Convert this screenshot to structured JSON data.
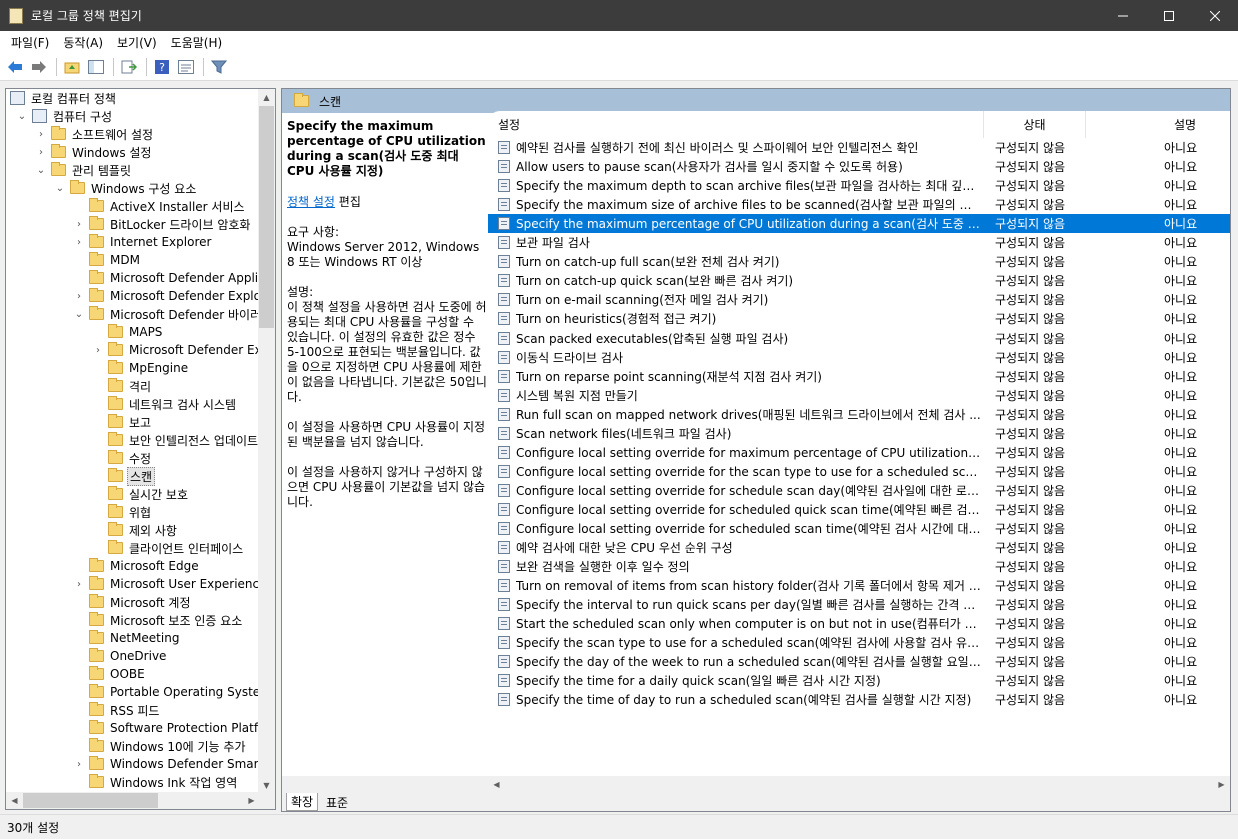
{
  "window": {
    "title": "로컬 그룹 정책 편집기"
  },
  "menu": [
    "파일(F)",
    "동작(A)",
    "보기(V)",
    "도움말(H)"
  ],
  "tree": [
    {
      "label": "로컬 컴퓨터 정책",
      "level": 0,
      "exp": "",
      "icon": "computer-policy-icon"
    },
    {
      "label": "컴퓨터 구성",
      "level": 1,
      "exp": "open",
      "icon": "computer-icon"
    },
    {
      "label": "소프트웨어 설정",
      "level": 2,
      "exp": "closed",
      "icon": "folder-icon"
    },
    {
      "label": "Windows 설정",
      "level": 2,
      "exp": "closed",
      "icon": "folder-icon"
    },
    {
      "label": "관리 템플릿",
      "level": 2,
      "exp": "open",
      "icon": "folder-icon"
    },
    {
      "label": "Windows 구성 요소",
      "level": 3,
      "exp": "open",
      "icon": "folder-icon"
    },
    {
      "label": "ActiveX Installer 서비스",
      "level": 4,
      "exp": "",
      "icon": "folder-icon"
    },
    {
      "label": "BitLocker 드라이브 암호화",
      "level": 4,
      "exp": "closed",
      "icon": "folder-icon"
    },
    {
      "label": "Internet Explorer",
      "level": 4,
      "exp": "closed",
      "icon": "folder-icon"
    },
    {
      "label": "MDM",
      "level": 4,
      "exp": "",
      "icon": "folder-icon"
    },
    {
      "label": "Microsoft Defender Applicat",
      "level": 4,
      "exp": "",
      "icon": "folder-icon"
    },
    {
      "label": "Microsoft Defender Exploit G",
      "level": 4,
      "exp": "closed",
      "icon": "folder-icon"
    },
    {
      "label": "Microsoft Defender 바이러스",
      "level": 4,
      "exp": "open",
      "icon": "folder-icon"
    },
    {
      "label": "MAPS",
      "level": 5,
      "exp": "",
      "icon": "folder-icon"
    },
    {
      "label": "Microsoft Defender Exploi",
      "level": 5,
      "exp": "closed",
      "icon": "folder-icon"
    },
    {
      "label": "MpEngine",
      "level": 5,
      "exp": "",
      "icon": "folder-icon"
    },
    {
      "label": "격리",
      "level": 5,
      "exp": "",
      "icon": "folder-icon"
    },
    {
      "label": "네트워크 검사 시스템",
      "level": 5,
      "exp": "",
      "icon": "folder-icon"
    },
    {
      "label": "보고",
      "level": 5,
      "exp": "",
      "icon": "folder-icon"
    },
    {
      "label": "보안 인텔리전스 업데이트",
      "level": 5,
      "exp": "",
      "icon": "folder-icon"
    },
    {
      "label": "수정",
      "level": 5,
      "exp": "",
      "icon": "folder-icon"
    },
    {
      "label": "스캔",
      "level": 5,
      "exp": "",
      "icon": "folder-icon",
      "selected": true
    },
    {
      "label": "실시간 보호",
      "level": 5,
      "exp": "",
      "icon": "folder-icon"
    },
    {
      "label": "위협",
      "level": 5,
      "exp": "",
      "icon": "folder-icon"
    },
    {
      "label": "제외 사항",
      "level": 5,
      "exp": "",
      "icon": "folder-icon"
    },
    {
      "label": "클라이언트 인터페이스",
      "level": 5,
      "exp": "",
      "icon": "folder-icon"
    },
    {
      "label": "Microsoft Edge",
      "level": 4,
      "exp": "",
      "icon": "folder-icon"
    },
    {
      "label": "Microsoft User Experience V",
      "level": 4,
      "exp": "closed",
      "icon": "folder-icon"
    },
    {
      "label": "Microsoft 계정",
      "level": 4,
      "exp": "",
      "icon": "folder-icon"
    },
    {
      "label": "Microsoft 보조 인증 요소",
      "level": 4,
      "exp": "",
      "icon": "folder-icon"
    },
    {
      "label": "NetMeeting",
      "level": 4,
      "exp": "",
      "icon": "folder-icon"
    },
    {
      "label": "OneDrive",
      "level": 4,
      "exp": "",
      "icon": "folder-icon"
    },
    {
      "label": "OOBE",
      "level": 4,
      "exp": "",
      "icon": "folder-icon"
    },
    {
      "label": "Portable Operating System",
      "level": 4,
      "exp": "",
      "icon": "folder-icon"
    },
    {
      "label": "RSS 피드",
      "level": 4,
      "exp": "",
      "icon": "folder-icon"
    },
    {
      "label": "Software Protection Platform",
      "level": 4,
      "exp": "",
      "icon": "folder-icon"
    },
    {
      "label": "Windows 10에 기능 추가",
      "level": 4,
      "exp": "",
      "icon": "folder-icon"
    },
    {
      "label": "Windows Defender SmartSc",
      "level": 4,
      "exp": "closed",
      "icon": "folder-icon"
    },
    {
      "label": "Windows Ink 작업 영역",
      "level": 4,
      "exp": "",
      "icon": "folder-icon"
    }
  ],
  "header": {
    "title": "스캔"
  },
  "description": {
    "title": "Specify the maximum percentage of CPU utilization during a scan(검사 도중 최대 CPU 사용률 지정)",
    "edit_link": "정책 설정",
    "edit_suffix": " 편집",
    "req_label": "요구 사항:",
    "req_text": "Windows Server 2012, Windows 8 또는 Windows RT 이상",
    "desc_label": "설명:",
    "desc_text": "이 정책 설정을 사용하면 검사 도중에 허용되는 최대 CPU 사용률을 구성할 수 있습니다. 이 설정의 유효한 값은 정수 5-100으로 표현되는 백분율입니다. 값을 0으로 지정하면 CPU 사용률에 제한이 없음을 나타냅니다. 기본값은 50입니다.",
    "p2": "이 설정을 사용하면 CPU 사용률이 지정된 백분율을 넘지 않습니다.",
    "p3": "이 설정을 사용하지 않거나 구성하지 않으면 CPU 사용률이 기본값을 넘지 않습니다."
  },
  "columns": {
    "setting": "설정",
    "state": "상태",
    "comment": "설명"
  },
  "settings": [
    {
      "name": "예약된 검사를 실행하기 전에 최신 바이러스 및 스파이웨어 보안 인텔리전스 확인",
      "state": "구성되지 않음",
      "comment": "아니요"
    },
    {
      "name": "Allow users to pause scan(사용자가 검사를 일시 중지할 수 있도록 허용)",
      "state": "구성되지 않음",
      "comment": "아니요"
    },
    {
      "name": "Specify the maximum depth to scan archive files(보관 파일을 검사하는 최대 깊이 지...",
      "state": "구성되지 않음",
      "comment": "아니요"
    },
    {
      "name": "Specify the maximum size of archive files to be scanned(검사할 보관 파일의 최대 ...",
      "state": "구성되지 않음",
      "comment": "아니요"
    },
    {
      "name": "Specify the maximum percentage of CPU utilization during a scan(검사 도중 최대 C...",
      "state": "구성되지 않음",
      "comment": "아니요",
      "selected": true
    },
    {
      "name": "보관 파일 검사",
      "state": "구성되지 않음",
      "comment": "아니요"
    },
    {
      "name": "Turn on catch-up full scan(보완 전체 검사 켜기)",
      "state": "구성되지 않음",
      "comment": "아니요"
    },
    {
      "name": "Turn on catch-up quick scan(보완 빠른 검사 켜기)",
      "state": "구성되지 않음",
      "comment": "아니요"
    },
    {
      "name": "Turn on e-mail scanning(전자 메일 검사 켜기)",
      "state": "구성되지 않음",
      "comment": "아니요"
    },
    {
      "name": "Turn on heuristics(경험적 접근 켜기)",
      "state": "구성되지 않음",
      "comment": "아니요"
    },
    {
      "name": "Scan packed executables(압축된 실행 파일 검사)",
      "state": "구성되지 않음",
      "comment": "아니요"
    },
    {
      "name": "이동식 드라이브 검사",
      "state": "구성되지 않음",
      "comment": "아니요"
    },
    {
      "name": "Turn on reparse point scanning(재분석 지점 검사 켜기)",
      "state": "구성되지 않음",
      "comment": "아니요"
    },
    {
      "name": "시스템 복원 지점 만들기",
      "state": "구성되지 않음",
      "comment": "아니요"
    },
    {
      "name": "Run full scan on mapped network drives(매핑된 네트워크 드라이브에서 전체 검사 ...",
      "state": "구성되지 않음",
      "comment": "아니요"
    },
    {
      "name": "Scan network files(네트워크 파일 검사)",
      "state": "구성되지 않음",
      "comment": "아니요"
    },
    {
      "name": "Configure local setting override for maximum percentage of CPU utilization(최대 CP...",
      "state": "구성되지 않음",
      "comment": "아니요"
    },
    {
      "name": "Configure local setting override for the scan type to use for a scheduled scan(예약된...",
      "state": "구성되지 않음",
      "comment": "아니요"
    },
    {
      "name": "Configure local setting override for schedule scan day(예약된 검사일에 대한 로컬 설...",
      "state": "구성되지 않음",
      "comment": "아니요"
    },
    {
      "name": "Configure local setting override for scheduled quick scan time(예약된 빠른 검사 시...",
      "state": "구성되지 않음",
      "comment": "아니요"
    },
    {
      "name": "Configure local setting override for scheduled scan time(예약된 검사 시간에 대한 로...",
      "state": "구성되지 않음",
      "comment": "아니요"
    },
    {
      "name": "예약 검사에 대한 낮은 CPU 우선 순위 구성",
      "state": "구성되지 않음",
      "comment": "아니요"
    },
    {
      "name": "보완 검색을 실행한 이후 일수 정의",
      "state": "구성되지 않음",
      "comment": "아니요"
    },
    {
      "name": "Turn on removal of items from scan history folder(검사 기록 폴더에서 항목 제거 켜...",
      "state": "구성되지 않음",
      "comment": "아니요"
    },
    {
      "name": "Specify the interval to run quick scans per day(일별 빠른 검사를 실행하는 간격 지정)",
      "state": "구성되지 않음",
      "comment": "아니요"
    },
    {
      "name": "Start the scheduled scan only when computer is on but not in use(컴퓨터가 켜져 있...",
      "state": "구성되지 않음",
      "comment": "아니요"
    },
    {
      "name": "Specify the scan type to use for a scheduled scan(예약된 검사에 사용할 검사 유형 ...",
      "state": "구성되지 않음",
      "comment": "아니요"
    },
    {
      "name": "Specify the day of the week to run a scheduled scan(예약된 검사를 실행할 요일 지정)",
      "state": "구성되지 않음",
      "comment": "아니요"
    },
    {
      "name": "Specify the time for a daily quick scan(일일 빠른 검사 시간 지정)",
      "state": "구성되지 않음",
      "comment": "아니요"
    },
    {
      "name": "Specify the time of day to run a scheduled scan(예약된 검사를 실행할 시간 지정)",
      "state": "구성되지 않음",
      "comment": "아니요"
    }
  ],
  "tabs": [
    "확장",
    "표준"
  ],
  "status": {
    "text": "30개 설정"
  },
  "colors": {
    "selection": "#0078d7",
    "header_band": "#a8bfd8",
    "titlebar": "#3c3c3c"
  }
}
